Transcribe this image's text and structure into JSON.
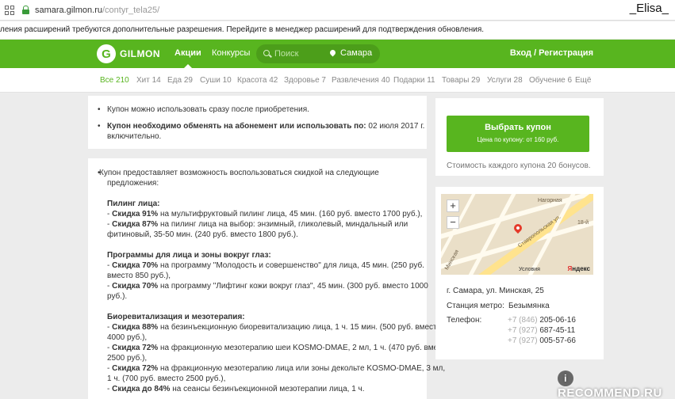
{
  "browser": {
    "url_domain": "samara.gilmon.ru",
    "url_path": "/contyr_tela25/",
    "user_name": "_Elisa_"
  },
  "notice": {
    "text": "ления расширений требуются дополнительные разрешения. Перейдите в менеджер расширений для подтверждения обновления."
  },
  "header": {
    "logo_letter": "G",
    "logo_text": "GILMON",
    "nav": [
      "Акции",
      "Конкурсы"
    ],
    "search_placeholder": "Поиск",
    "city": "Самара",
    "login": "Вход / Регистрация"
  },
  "categories": [
    "Все 210",
    "Хит 14",
    "Еда 29",
    "Суши 10",
    "Красота 42",
    "Здоровье 7",
    "Развлечения 40",
    "Подарки 11",
    "Товары 29",
    "Услуги 28",
    "Обучение 6",
    "Ещё"
  ],
  "card1": {
    "bullet1": "Купон можно использовать сразу после приобретения.",
    "bullet2_bold": "Купон необходимо обменять на абонемент или использовать по:",
    "bullet2_rest": " 02 июля 2017 г.",
    "bullet2_line2": "включительно."
  },
  "card2": {
    "intro_line1": "Купон предоставляет возможность воспользоваться скидкой на следующие",
    "intro_line2": "предложения:",
    "sec1_title": "Пилинг лица:",
    "sec1_l1_b": "Скидка 91%",
    "sec1_l1": " на мультифруктовый пилинг лица, 45 мин. (160 руб. вместо 1700 руб.),",
    "sec1_l2_b": "Скидка 87%",
    "sec1_l2": " на пилинг лица на выбор: энзимный, гликолевый, миндальный или",
    "sec1_l3": "фитиновый, 35-50 мин. (240 руб. вместо 1800 руб.).",
    "sec2_title": "Программы для лица и зоны вокруг глаз:",
    "sec2_l1_b": "Скидка 70%",
    "sec2_l1": " на программу \"Молодость и совершенство\" для лица, 45 мин. (250 руб.",
    "sec2_l2": "вместо 850 руб.),",
    "sec2_l3_b": "Скидка 70%",
    "sec2_l3": " на программу \"Лифтинг кожи вокруг глаз\", 45 мин. (300 руб. вместо 1000",
    "sec2_l4": "руб.).",
    "sec3_title": "Биоревитализация и мезотерапия:",
    "sec3_l1_b": "Скидка 88%",
    "sec3_l1": " на безинъекционную биоревитализацию лица, 1 ч. 15 мин. (500 руб. вместо",
    "sec3_l2": "4000 руб.),",
    "sec3_l3_b": "Скидка 72%",
    "sec3_l3": " на фракционную мезотерапию шеи KOSMO-DMAE, 2 мл, 1 ч. (470 руб. вместо",
    "sec3_l4": "2500 руб.),",
    "sec3_l5_b": "Скидка 72%",
    "sec3_l5": " на фракционную мезотерапию лица или зоны декольте KOSMO-DMAE, 3 мл,",
    "sec3_l6": "1 ч. (700 руб. вместо 2500 руб.),",
    "sec3_l7_b": "Скидка до 84%",
    "sec3_l7": " на сеансы безинъекционной мезотерапии лица, 1 ч."
  },
  "buy": {
    "button_title": "Выбрать купон",
    "button_sub": "Цена по купону: от 160 руб.",
    "bonus": "Стоимость каждого купона 20 бонусов."
  },
  "location": {
    "map_street1": "Нагорная",
    "map_street2": "Ставропольская ул.",
    "map_street3": "18-й",
    "map_street4": "Минская",
    "map_terms": "Условия",
    "map_brand_a": "Я",
    "map_brand_b": "ндекс",
    "address": "г. Самара, ул. Минская, 25",
    "metro_label": "Станция метро:",
    "metro_value": "Безымянка",
    "phone_label": "Телефон:",
    "phones": [
      {
        "code": "+7 (846)",
        "num": "205-06-16"
      },
      {
        "code": "+7 (927)",
        "num": "687-45-11"
      },
      {
        "code": "+7 (927)",
        "num": "005-57-66"
      }
    ]
  },
  "watermark": {
    "icon_text": "i",
    "text": "RECOMMEND.RU"
  },
  "colors": {
    "brand_green": "#58b51f",
    "page_bg": "#ececec"
  }
}
